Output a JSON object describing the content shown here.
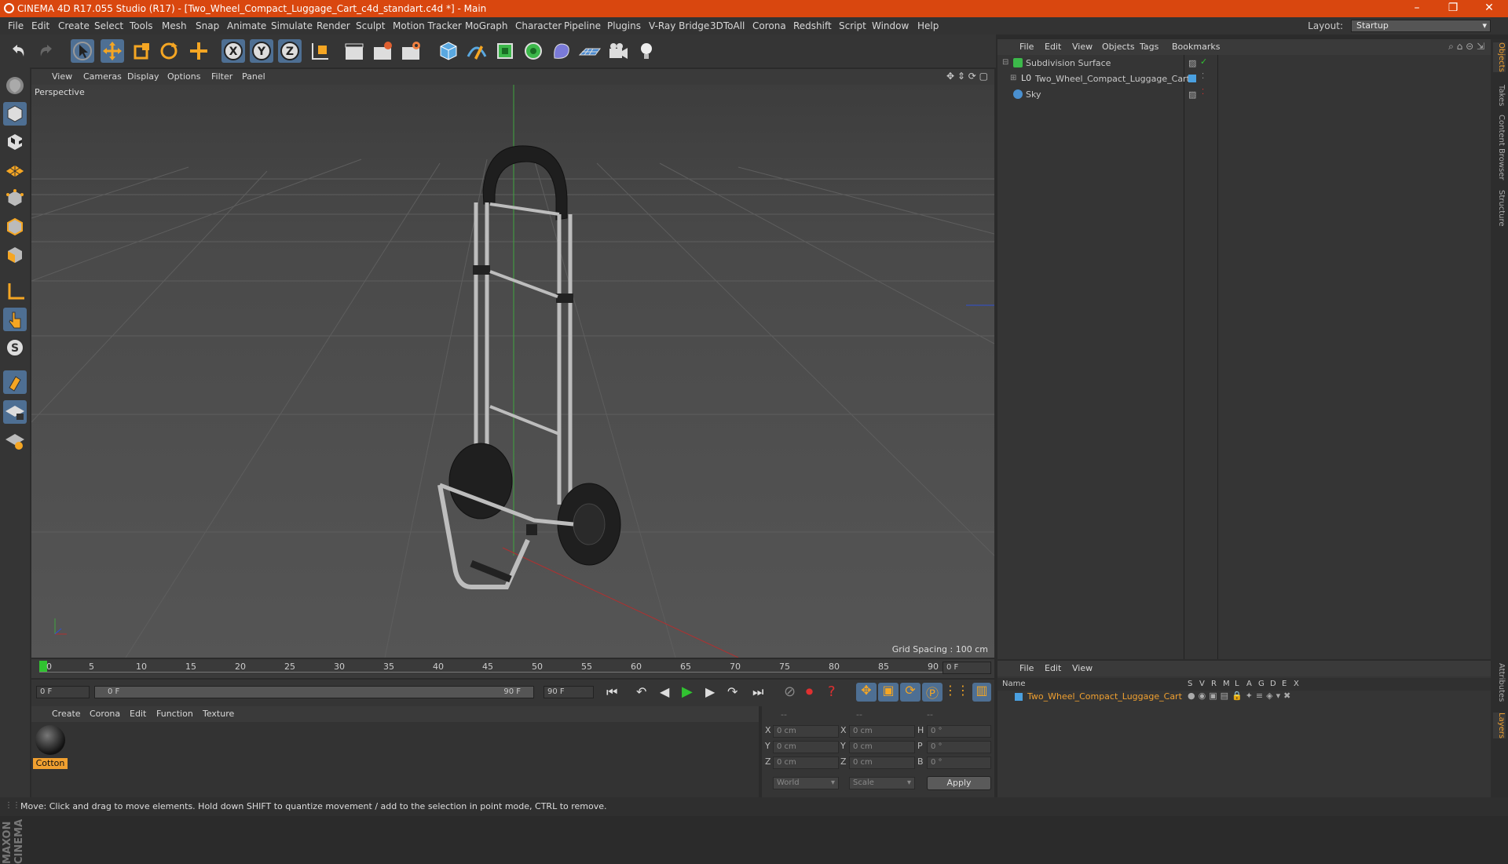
{
  "window": {
    "title": "CINEMA 4D R17.055 Studio (R17) - [Two_Wheel_Compact_Luggage_Cart_c4d_standart.c4d *] - Main",
    "controls": [
      "–",
      "❐",
      "✕"
    ]
  },
  "menubar": {
    "items": [
      "File",
      "Edit",
      "Create",
      "Select",
      "Tools",
      "Mesh",
      "Snap",
      "Animate",
      "Simulate",
      "Render",
      "Sculpt",
      "Motion Tracker",
      "MoGraph",
      "Character",
      "Pipeline",
      "Plugins",
      "V-Ray Bridge",
      "3DToAll",
      "Corona",
      "Redshift",
      "Script",
      "Window",
      "Help"
    ],
    "layout_label": "Layout:",
    "layout_value": "Startup"
  },
  "toolbar": {
    "icons": [
      "undo-icon",
      "redo-icon",
      "select-arrow-icon",
      "move-icon",
      "scale-icon",
      "rotate-icon",
      "add-icon",
      "x-axis-icon",
      "y-axis-icon",
      "z-axis-icon",
      "coordinate-system-icon",
      "render-view-icon",
      "render-picture-viewer-icon",
      "edit-render-settings-icon",
      "cube-icon",
      "pen-spline-icon",
      "subdivision-icon",
      "cloner-icon",
      "deformer-icon",
      "floor-icon",
      "camera-icon",
      "light-icon"
    ],
    "axis_labels": [
      "X",
      "Y",
      "Z"
    ]
  },
  "viewport": {
    "menu": [
      "View",
      "Cameras",
      "Display",
      "Options",
      "Filter",
      "Panel"
    ],
    "label": "Perspective",
    "grid_spacing": "Grid Spacing : 100 cm"
  },
  "timeline": {
    "ticks": [
      "0",
      "5",
      "10",
      "15",
      "20",
      "25",
      "30",
      "35",
      "40",
      "45",
      "50",
      "55",
      "60",
      "65",
      "70",
      "75",
      "80",
      "85",
      "90"
    ],
    "current_frame": "0 F",
    "start_frame": "0 F",
    "range_start": "0 F",
    "range_end": "90 F",
    "end_frame": "90 F"
  },
  "material_panel": {
    "menu": [
      "Create",
      "Corona",
      "Edit",
      "Function",
      "Texture"
    ],
    "material_name": "Cotton"
  },
  "coordinates": {
    "headers": [
      "--",
      "--",
      "--"
    ],
    "rows": [
      {
        "axis": "X",
        "pos": "0 cm",
        "axis2": "X",
        "size": "0 cm",
        "rot_label": "H",
        "rot": "0 °"
      },
      {
        "axis": "Y",
        "pos": "0 cm",
        "axis2": "Y",
        "size": "0 cm",
        "rot_label": "P",
        "rot": "0 °"
      },
      {
        "axis": "Z",
        "pos": "0 cm",
        "axis2": "Z",
        "size": "0 cm",
        "rot_label": "B",
        "rot": "0 °"
      }
    ],
    "mode": "World",
    "size_mode": "Scale",
    "apply_label": "Apply"
  },
  "object_manager": {
    "menu": [
      "File",
      "Edit",
      "View",
      "Objects",
      "Tags",
      "Bookmarks"
    ],
    "objects": [
      {
        "name": "Subdivision Surface",
        "icon": "subdivision-icon",
        "color": "#7fd36f"
      },
      {
        "name": "Two_Wheel_Compact_Luggage_Cart",
        "icon": "null-object-icon",
        "color": "#c8c8c8"
      },
      {
        "name": "Sky",
        "icon": "sky-icon",
        "color": "#c8c8c8"
      }
    ]
  },
  "layer_manager": {
    "menu": [
      "File",
      "Edit",
      "View"
    ],
    "column_name": "Name",
    "columns": [
      "S",
      "V",
      "R",
      "M",
      "L",
      "A",
      "G",
      "D",
      "E",
      "X"
    ],
    "layer_name": "Two_Wheel_Compact_Luggage_Cart",
    "layer_color": "#f0a030"
  },
  "right_tabs": [
    "Objects",
    "Takes",
    "Content Browser",
    "Structure",
    "Attributes",
    "Layers"
  ],
  "branding": "MAXON CINEMA 4D",
  "status": "Move: Click and drag to move elements. Hold down SHIFT to quantize movement / add to the selection in point mode, CTRL to remove.",
  "colors": {
    "titlebar": "#d9470f",
    "selected_tool": "#4e6f93",
    "accent_orange": "#f0a030",
    "timeline_green": "#31c231"
  }
}
